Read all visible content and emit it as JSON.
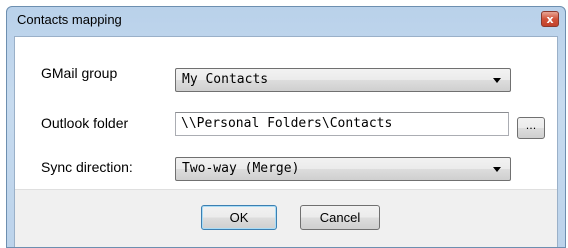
{
  "window": {
    "title": "Contacts mapping",
    "close_glyph": "x"
  },
  "form": {
    "gmail_group_label": "GMail group",
    "gmail_group_value": "My Contacts",
    "outlook_folder_label": "Outlook folder",
    "outlook_folder_value": "\\\\Personal Folders\\Contacts",
    "browse_label": "...",
    "sync_direction_label": "Sync direction:",
    "sync_direction_value": "Two-way (Merge)"
  },
  "buttons": {
    "ok_label": "OK",
    "cancel_label": "Cancel"
  },
  "icons": {
    "close": "close-icon",
    "dropdown": "chevron-down-icon"
  },
  "colors": {
    "titlebar": "#bcd3eb",
    "close_button": "#d0533a",
    "footer": "#f0f0f0",
    "default_button_border": "#3c7fb1"
  }
}
